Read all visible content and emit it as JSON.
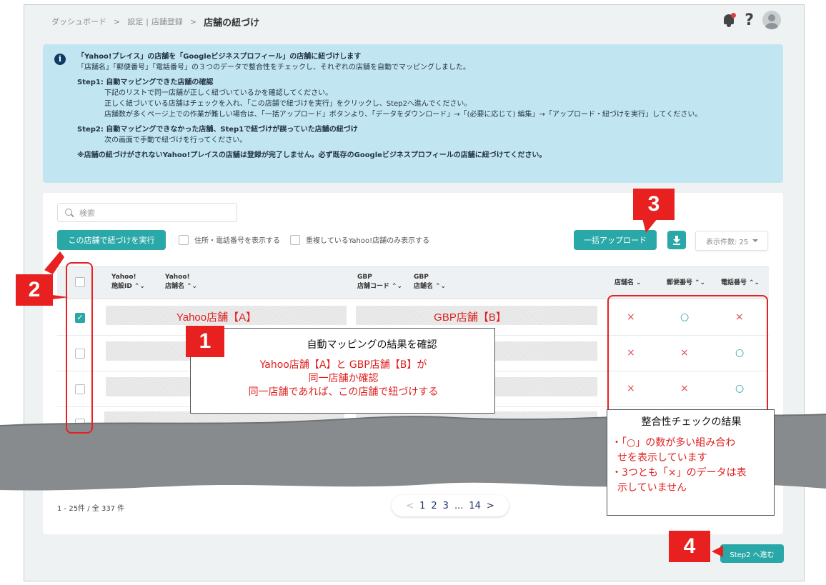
{
  "breadcrumb": {
    "items": [
      "ダッシュボード",
      "設定",
      "店舗登録"
    ],
    "separators": [
      ">",
      "|",
      ">"
    ],
    "current": "店舗の紐づけ"
  },
  "top_icons": [
    "bell-icon",
    "help-icon",
    "avatar-icon"
  ],
  "info": {
    "line1": "「Yahoo!プレイス」の店舗を「Googleビジネスプロフィール」の店舗に紐づけします",
    "line2": "「店舗名」「郵便番号」「電話番号」の３つのデータで整合性をチェックし、それぞれの店舗を自動でマッピングしました。",
    "step1_title": "Step1: 自動マッピングできた店舗の確認",
    "step1_l1": "下記のリストで同一店舗が正しく紐づいているかを確認してください。",
    "step1_l2": "正しく紐づいている店舗はチェックを入れ、「この店舗で紐づけを実行」をクリックし、Step2へ進んでください。",
    "step1_l3": "店舗数が多くページ上での作業が難しい場合は、「一括アップロード」ボタンより、「データをダウンロード」→「(必要に応じて) 編集」→「アップロード・紐づけを実行」してください。",
    "step2_title": "Step2: 自動マッピングできなかった店舗、Step1で紐づけが誤っていた店舗の紐づけ",
    "step2_l1": "次の画面で手動で紐づけを行ってください。",
    "note": "※店舗の紐づけがされないYahoo!プレイスの店舗は登録が完了しません。必ず既存のGoogleビジネスプロフィールの店舗に紐づけてください。"
  },
  "search": {
    "placeholder": "検索"
  },
  "toolbar": {
    "execute_label": "この店舗で紐づけを実行",
    "show_address_label": "住所・電話番号を表示する",
    "duplicate_only_label": "重複しているYahoo!店舗のみ表示する",
    "bulk_upload_label": "一括アップロード",
    "per_page_label": "表示件数: 25"
  },
  "table": {
    "headers": {
      "yahoo_id": [
        "Yahoo!",
        "施設ID"
      ],
      "yahoo_name": [
        "Yahoo!",
        "店舗名"
      ],
      "gbp_code": [
        "GBP",
        "店舗コード"
      ],
      "gbp_name": [
        "GBP",
        "店舗名"
      ],
      "match_name": "店舗名",
      "match_zip": "郵便番号",
      "match_tel": "電話番号"
    },
    "sort_glyph": "⌃⌄",
    "name_caret": "⌄",
    "rows": [
      {
        "checked": true,
        "yahoo": "Yahoo店舗【A】",
        "gbp": "GBP店舗【B】",
        "name": "×",
        "zip": "○",
        "tel": "×"
      },
      {
        "checked": false,
        "yahoo": "",
        "gbp": "",
        "name": "×",
        "zip": "×",
        "tel": "○"
      },
      {
        "checked": false,
        "yahoo": "",
        "gbp": "",
        "name": "×",
        "zip": "×",
        "tel": "○"
      },
      {
        "checked": false,
        "yahoo": "",
        "gbp": "",
        "name": "",
        "zip": "",
        "tel": ""
      }
    ]
  },
  "footer": {
    "count": "1 - 25件 / 全 337 件",
    "prev": "<",
    "pages": [
      "1",
      "2",
      "3",
      "...",
      "14"
    ],
    "next": ">"
  },
  "step2_button": "Step2 へ進む",
  "annotations": {
    "badge1": "1",
    "badge2": "2",
    "badge3": "3",
    "badge4": "4",
    "box1_title": "自動マッピングの結果を確認",
    "box1_l1": "Yahoo店舗【A】と GBP店舗【B】が",
    "box1_l2": "同一店舗か確認",
    "box1_l3": "同一店舗であれば、この店舗で紐づけする",
    "box2_title": "整合性チェックの結果",
    "box2_l1": "・「○」の数が多い組み合わ",
    "box2_l2": "せを表示しています",
    "box2_l3": "・3つとも「×」のデータは表",
    "box2_l4": "示していません"
  },
  "colors": {
    "accent": "#2aa8a8",
    "annotation_red": "#e8201f",
    "info_bg": "#c2e6f1",
    "cross": "#e34b5a",
    "circle": "#2b9ea0"
  }
}
